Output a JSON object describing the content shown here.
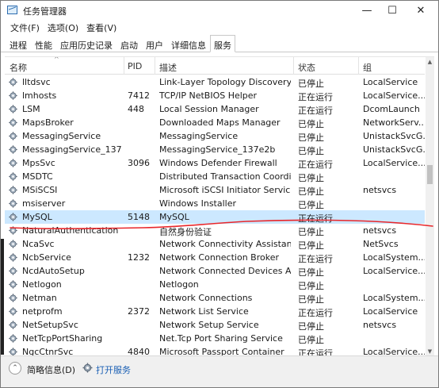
{
  "window": {
    "title": "任务管理器",
    "minimize_glyph": "—",
    "maximize_glyph": "☐",
    "close_glyph": "✕"
  },
  "menu": [
    {
      "label": "文件(F)"
    },
    {
      "label": "选项(O)"
    },
    {
      "label": "查看(V)"
    }
  ],
  "tabs": [
    {
      "label": "进程"
    },
    {
      "label": "性能"
    },
    {
      "label": "应用历史记录"
    },
    {
      "label": "启动"
    },
    {
      "label": "用户"
    },
    {
      "label": "详细信息"
    },
    {
      "label": "服务",
      "active": true
    }
  ],
  "table": {
    "columns": [
      "名称",
      "PID",
      "描述",
      "状态",
      "组"
    ],
    "sort_arrow": "^",
    "rows": [
      {
        "name": "lltdsvc",
        "pid": "",
        "desc": "Link-Layer Topology Discovery ...",
        "status": "已停止",
        "group": "LocalService"
      },
      {
        "name": "lmhosts",
        "pid": "7412",
        "desc": "TCP/IP NetBIOS Helper",
        "status": "正在运行",
        "group": "LocalService..."
      },
      {
        "name": "LSM",
        "pid": "448",
        "desc": "Local Session Manager",
        "status": "正在运行",
        "group": "DcomLaunch"
      },
      {
        "name": "MapsBroker",
        "pid": "",
        "desc": "Downloaded Maps Manager",
        "status": "已停止",
        "group": "NetworkServ..."
      },
      {
        "name": "MessagingService",
        "pid": "",
        "desc": "MessagingService",
        "status": "已停止",
        "group": "UnistackSvcG..."
      },
      {
        "name": "MessagingService_137e2b",
        "pid": "",
        "desc": "MessagingService_137e2b",
        "status": "已停止",
        "group": "UnistackSvcG..."
      },
      {
        "name": "MpsSvc",
        "pid": "3096",
        "desc": "Windows Defender Firewall",
        "status": "正在运行",
        "group": "LocalService..."
      },
      {
        "name": "MSDTC",
        "pid": "",
        "desc": "Distributed Transaction Coordina...",
        "status": "已停止",
        "group": ""
      },
      {
        "name": "MSiSCSI",
        "pid": "",
        "desc": "Microsoft iSCSI Initiator Service",
        "status": "已停止",
        "group": "netsvcs"
      },
      {
        "name": "msiserver",
        "pid": "",
        "desc": "Windows Installer",
        "status": "已停止",
        "group": ""
      },
      {
        "name": "MySQL",
        "pid": "5148",
        "desc": "MySQL",
        "status": "正在运行",
        "group": "",
        "selected": true
      },
      {
        "name": "NaturalAuthentication",
        "pid": "",
        "desc": "自然身份验证",
        "status": "已停止",
        "group": "netsvcs"
      },
      {
        "name": "NcaSvc",
        "pid": "",
        "desc": "Network Connectivity Assistant",
        "status": "已停止",
        "group": "NetSvcs"
      },
      {
        "name": "NcbService",
        "pid": "1232",
        "desc": "Network Connection Broker",
        "status": "正在运行",
        "group": "LocalSystem..."
      },
      {
        "name": "NcdAutoSetup",
        "pid": "",
        "desc": "Network Connected Devices Aut...",
        "status": "已停止",
        "group": "LocalService..."
      },
      {
        "name": "Netlogon",
        "pid": "",
        "desc": "Netlogon",
        "status": "已停止",
        "group": ""
      },
      {
        "name": "Netman",
        "pid": "",
        "desc": "Network Connections",
        "status": "已停止",
        "group": "LocalSystem..."
      },
      {
        "name": "netprofm",
        "pid": "2372",
        "desc": "Network List Service",
        "status": "正在运行",
        "group": "LocalService"
      },
      {
        "name": "NetSetupSvc",
        "pid": "",
        "desc": "Network Setup Service",
        "status": "已停止",
        "group": "netsvcs"
      },
      {
        "name": "NetTcpPortSharing",
        "pid": "",
        "desc": "Net.Tcp Port Sharing Service",
        "status": "已停止",
        "group": ""
      },
      {
        "name": "NgcCtnrSvc",
        "pid": "4840",
        "desc": "Microsoft Passport Container",
        "status": "正在运行",
        "group": "LocalService..."
      }
    ]
  },
  "footer": {
    "collapse_label": "简略信息(D)",
    "collapse_glyph": "⌃",
    "open_services_link": "打开服务"
  },
  "colors": {
    "selected_row": "#cce8ff",
    "annotation_red": "#e8272b",
    "link": "#1a5fb4"
  }
}
